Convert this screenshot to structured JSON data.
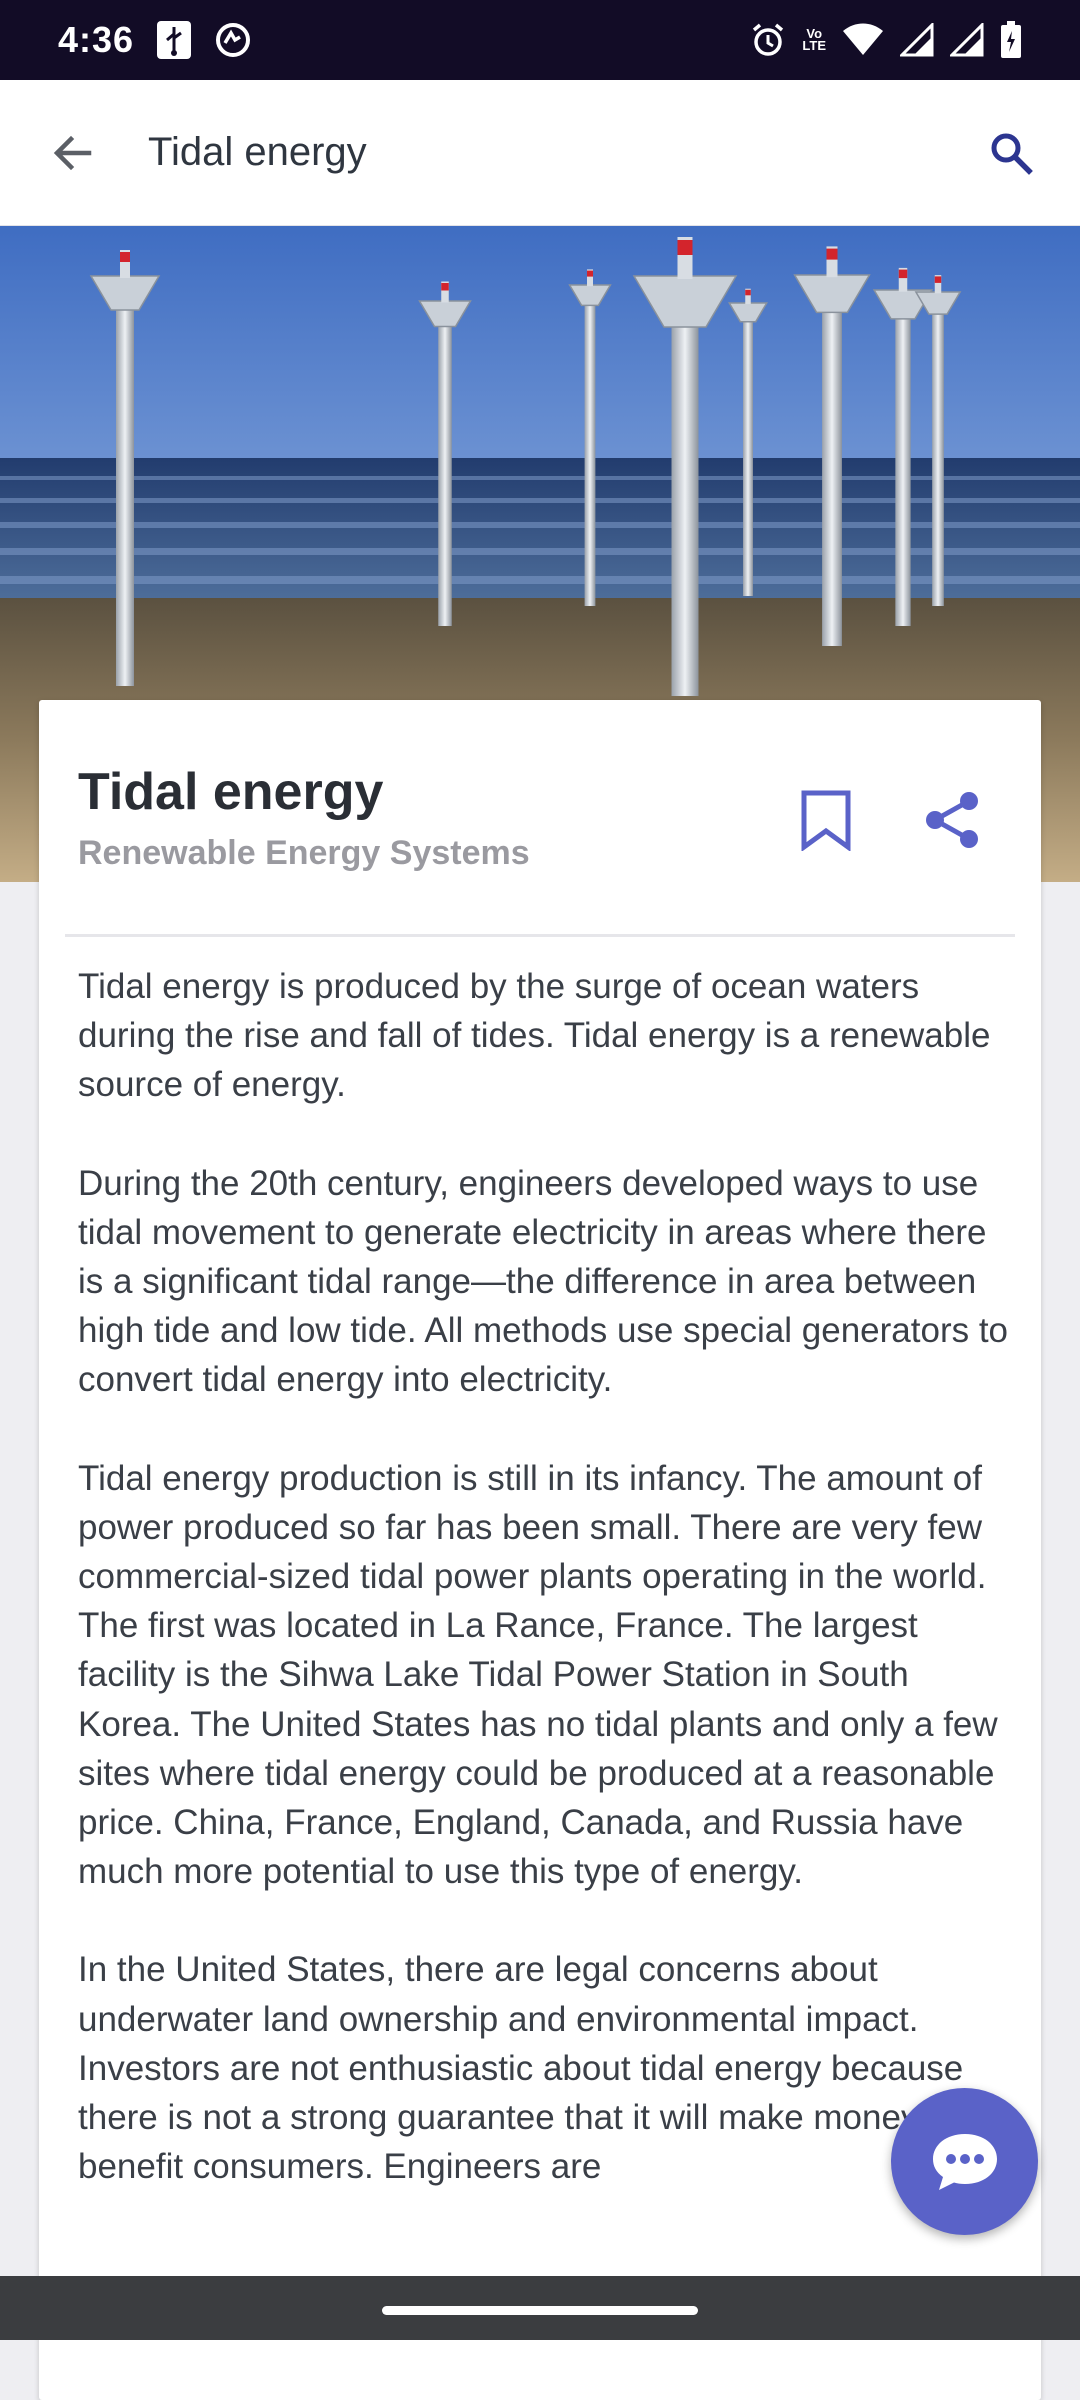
{
  "status_bar": {
    "time": "4:36",
    "network_label_top": "Vo",
    "network_label_bottom": "LTE",
    "icons": [
      "usb-icon",
      "data-saver-icon",
      "alarm-icon",
      "volte-icon",
      "wifi-icon",
      "signal-icon",
      "signal-icon",
      "battery-icon"
    ]
  },
  "app_bar": {
    "title": "Tidal energy",
    "back_icon": "arrow-back-icon",
    "search_icon": "search-icon"
  },
  "hero": {
    "image_subject": "tidal turbines in the sea"
  },
  "article": {
    "title": "Tidal energy",
    "subtitle": "Renewable Energy Systems",
    "bookmark_icon": "bookmark-icon",
    "share_icon": "share-icon",
    "paragraphs": [
      "Tidal energy is produced by the surge of ocean waters during the rise and fall of tides. Tidal energy is a renewable source of energy.",
      "During the 20th century, engineers developed ways to use tidal movement to generate electricity in areas where there is a significant tidal range—the difference in area between high tide and low tide. All methods use special generators to convert tidal energy into electricity.",
      "Tidal energy production is still in its infancy. The amount of power produced so far has been small. There are very few commercial-sized tidal power plants operating in the world. The first was located in La Rance, France. The largest facility is the Sihwa Lake Tidal Power Station in South Korea. The United States has no tidal plants and only a few sites where tidal energy could be produced at a reasonable price. China, France, England, Canada, and Russia have much more potential to use this type of energy.",
      "In the United States, there are legal concerns about underwater land ownership and environmental impact. Investors are not enthusiastic about tidal energy because there is not a strong guarantee that it will make money or benefit consumers. Engineers are"
    ]
  },
  "fab": {
    "icon": "chat-bubble-icon"
  },
  "colors": {
    "accent": "#5a62c8",
    "status_bar": "#120c26",
    "text_primary": "#2a2e35",
    "text_secondary": "#9a9aa0"
  }
}
